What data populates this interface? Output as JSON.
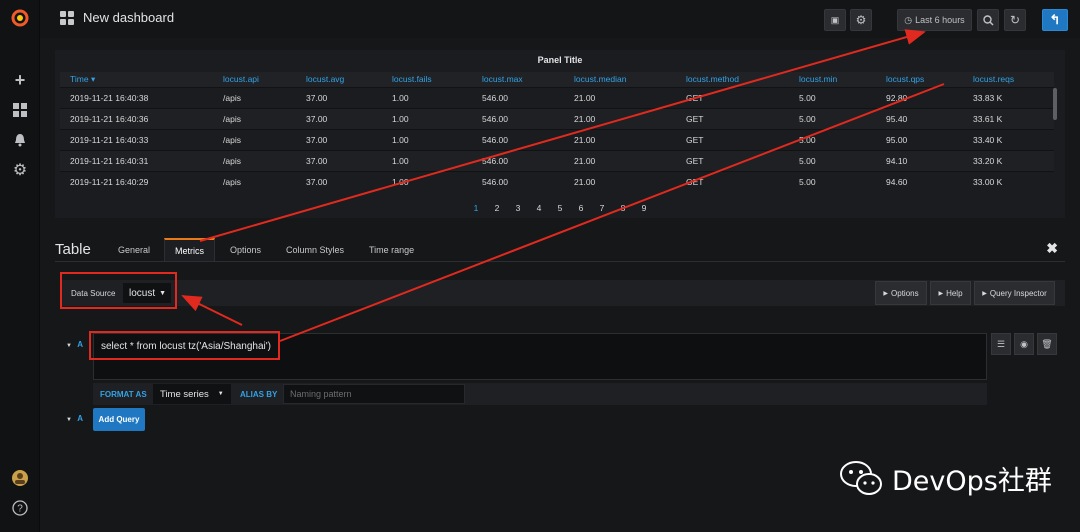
{
  "topbar": {
    "title": "New dashboard",
    "time_range": "Last 6 hours"
  },
  "panel": {
    "title": "Panel Title",
    "columns": [
      "Time",
      "locust.api",
      "locust.avg",
      "locust.fails",
      "locust.max",
      "locust.median",
      "locust.method",
      "locust.min",
      "locust.qps",
      "locust.reqs"
    ],
    "rows": [
      [
        "2019-11-21 16:40:38",
        "/apis",
        "37.00",
        "1.00",
        "546.00",
        "21.00",
        "GET",
        "5.00",
        "92.80",
        "33.83 K"
      ],
      [
        "2019-11-21 16:40:36",
        "/apis",
        "37.00",
        "1.00",
        "546.00",
        "21.00",
        "GET",
        "5.00",
        "95.40",
        "33.61 K"
      ],
      [
        "2019-11-21 16:40:33",
        "/apis",
        "37.00",
        "1.00",
        "546.00",
        "21.00",
        "GET",
        "5.00",
        "95.00",
        "33.40 K"
      ],
      [
        "2019-11-21 16:40:31",
        "/apis",
        "37.00",
        "1.00",
        "546.00",
        "21.00",
        "GET",
        "5.00",
        "94.10",
        "33.20 K"
      ],
      [
        "2019-11-21 16:40:29",
        "/apis",
        "37.00",
        "1.00",
        "546.00",
        "21.00",
        "GET",
        "5.00",
        "94.60",
        "33.00 K"
      ]
    ],
    "pages": [
      "1",
      "2",
      "3",
      "4",
      "5",
      "6",
      "7",
      "8",
      "9"
    ]
  },
  "editor": {
    "title": "Table",
    "tabs": [
      "General",
      "Metrics",
      "Options",
      "Column Styles",
      "Time range"
    ],
    "active_tab": "Metrics",
    "datasource_label": "Data Source",
    "datasource_value": "locust",
    "buttons": {
      "options": "Options",
      "help": "Help",
      "inspector": "Query Inspector"
    },
    "query": {
      "letter": "A",
      "text": "select * from locust tz('Asia/Shanghai')",
      "format_label": "FORMAT AS",
      "format_value": "Time series",
      "alias_label": "ALIAS BY",
      "alias_placeholder": "Naming pattern"
    },
    "add_query_letter": "A",
    "add_query": "Add Query"
  },
  "colors": {
    "accent_blue": "#33a2e5",
    "button_blue": "#1f78c1",
    "annotation_red": "#e02a1f",
    "tab_orange": "#eb7b18"
  },
  "watermark": "DevOps社群"
}
